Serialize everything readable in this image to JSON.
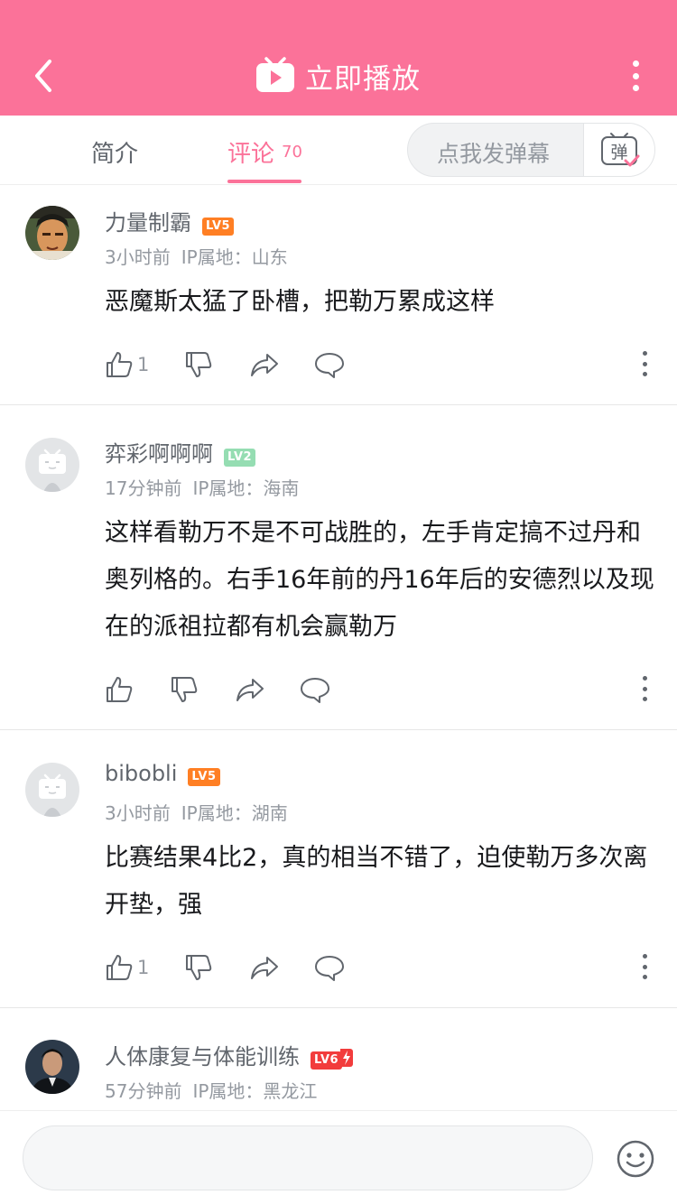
{
  "header": {
    "title": "立即播放",
    "colors": {
      "brand_pink": "#fb7299",
      "text_gray": "#61666d",
      "meta_gray": "#9499a0"
    }
  },
  "tabs": {
    "intro_label": "简介",
    "comments_label": "评论",
    "comments_count": "70",
    "danmaku_placeholder": "点我发弹幕",
    "danmaku_icon_label": "弹"
  },
  "comments": [
    {
      "username": "力量制霸",
      "level": "LV5",
      "level_color": "#ff7f24",
      "time": "3小时前",
      "ip": "IP属地：山东",
      "text": "恶魔斯太猛了卧槽，把勒万累成这样",
      "likes": "1",
      "avatar": "cartoon-character"
    },
    {
      "username": "弈彩啊啊啊",
      "level": "LV2",
      "level_color": "#95ddb2",
      "time": "17分钟前",
      "ip": "IP属地：海南",
      "text": "这样看勒万不是不可战胜的，左手肯定搞不过丹和奥列格的。右手16年前的丹16年后的安德烈以及现在的派祖拉都有机会赢勒万",
      "likes": "",
      "avatar": "default-tv"
    },
    {
      "username": "bibobli",
      "level": "LV5",
      "level_color": "#ff7f24",
      "time": "3小时前",
      "ip": "IP属地：湖南",
      "text": "比赛结果4比2，真的相当不错了，迫使勒万多次离开垫，强",
      "likes": "1",
      "avatar": "default-tv"
    },
    {
      "username": "人体康复与体能训练",
      "level": "LV6",
      "level_color": "#f23c3c",
      "time": "57分钟前",
      "ip": "IP属地：黑龙江",
      "avatar": "photo-person"
    }
  ],
  "icons": {
    "back": "chevron-left-icon",
    "play": "tv-icon",
    "more": "more-vertical-icon",
    "like": "thumb-up-icon",
    "dislike": "thumb-down-icon",
    "share": "share-icon",
    "reply": "comment-bubble-icon",
    "emoji": "smiley-icon"
  }
}
